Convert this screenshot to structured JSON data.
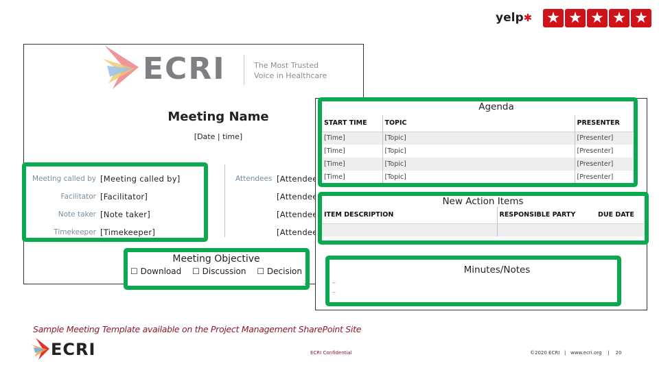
{
  "yelp": {
    "logo_text": "yelp",
    "rating": 5,
    "star_color": "#d0121b"
  },
  "doc": {
    "logo": {
      "brand": "ECRI",
      "tagline_1": "The Most Trusted",
      "tagline_2": "Voice in Healthcare"
    },
    "title": "Meeting Name",
    "date": "[Date | time]",
    "roles": [
      {
        "label": "Meeting called by",
        "value": "[Meeting called by]"
      },
      {
        "label": "Facilitator",
        "value": "[Facilitator]"
      },
      {
        "label": "Note taker",
        "value": "[Note taker]"
      },
      {
        "label": "Timekeeper",
        "value": "[Timekeeper]"
      }
    ],
    "attendees_label": "Attendees",
    "attendees": [
      "[Attendee",
      "[Attendee",
      "[Attendee",
      "[Attendee"
    ],
    "objective": {
      "title": "Meeting Objective",
      "options": [
        {
          "label": "Download",
          "checked": false
        },
        {
          "label": "Discussion",
          "checked": false
        },
        {
          "label": "Decision",
          "checked": false
        }
      ]
    }
  },
  "agenda": {
    "title": "Agenda",
    "headers": [
      "START TIME",
      "TOPIC",
      "PRESENTER"
    ],
    "rows": [
      [
        "[Time]",
        "[Topic]",
        "[Presenter]"
      ],
      [
        "[Time]",
        "[Topic]",
        "[Presenter]"
      ],
      [
        "[Time]",
        "[Topic]",
        "[Presenter]"
      ],
      [
        "[Time]",
        "[Topic]",
        "[Presenter]"
      ]
    ]
  },
  "actions": {
    "title": "New Action Items",
    "headers": [
      "ITEM DESCRIPTION",
      "RESPONSIBLE PARTY",
      "DUE DATE"
    ]
  },
  "minutes": {
    "title": "Minutes/Notes",
    "lines": [
      "_",
      "_"
    ]
  },
  "footer": {
    "caption": "Sample Meeting Template available on the Project Management SharePoint Site",
    "logo": "ECRI",
    "confidential": "ECRI Confidential",
    "copyright": "©2020 ECRI",
    "website": "www.ecri.org",
    "page": "20"
  },
  "colors": {
    "highlight": "#0aa84f",
    "caption": "#8b1a2b"
  }
}
